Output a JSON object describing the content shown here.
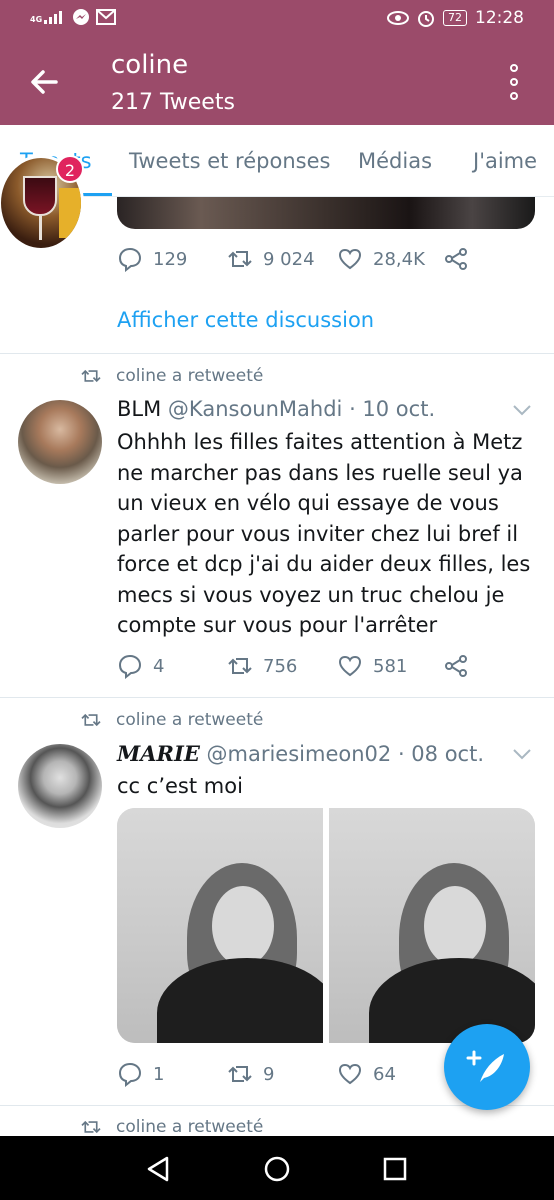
{
  "status_bar": {
    "network": "4G",
    "battery": "72",
    "time": "12:28"
  },
  "header": {
    "title": "coline",
    "subtitle": "217 Tweets"
  },
  "tabs": [
    {
      "label": "Tweets"
    },
    {
      "label": "Tweets et réponses"
    },
    {
      "label": "Médias"
    },
    {
      "label": "J'aime"
    }
  ],
  "notification_badge": "2",
  "tweet1": {
    "replies": "129",
    "retweets": "9 024",
    "likes": "28,4K",
    "discussion_link": "Afficher cette discussion"
  },
  "tweet2": {
    "retweet_label": "coline a retweeté",
    "name": "BLM",
    "handle": "@KansounMahdi",
    "date": "· 10 oct.",
    "text_lines": [
      "Ohhhh les filles faites attention à Metz",
      "ne marcher pas dans les ruelle seul ya",
      "un vieux en vélo qui essaye de vous",
      "parler pour vous inviter chez lui bref il",
      "force et dcp j'ai du aider deux filles, les",
      "mecs si vous voyez un truc chelou je",
      "compte sur vous pour l'arrêter"
    ],
    "replies": "4",
    "retweets": "756",
    "likes": "581"
  },
  "tweet3": {
    "retweet_label": "coline a retweeté",
    "name": "M𝑨RIE",
    "handle": "@mariesimeon02",
    "date": "· 08 oct.",
    "text": "cc c’est moi",
    "replies": "1",
    "retweets": "9",
    "likes": "64"
  },
  "tweet4": {
    "retweet_label": "coline a retweeté"
  },
  "colors": {
    "header_bg": "#9b4b6a",
    "accent": "#1da1f2",
    "secondary_text": "#657786"
  }
}
